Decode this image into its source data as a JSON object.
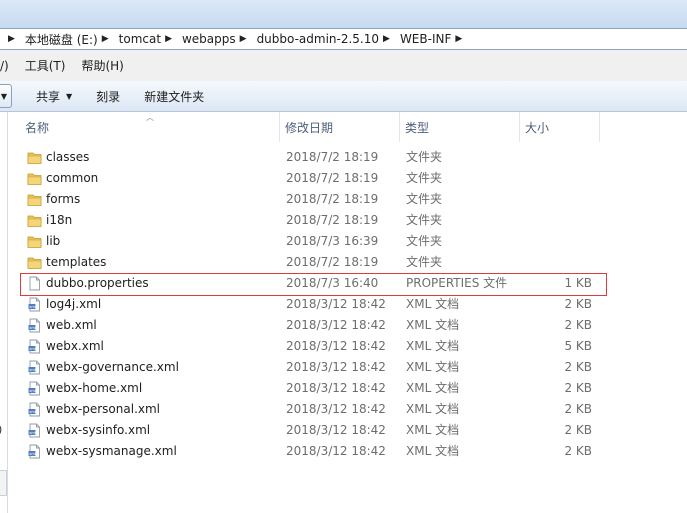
{
  "address": {
    "crumbs": [
      "本地磁盘 (E:)",
      "tomcat",
      "webapps",
      "dubbo-admin-2.5.10",
      "WEB-INF"
    ]
  },
  "menu": {
    "items": [
      "/)",
      "工具(T)",
      "帮助(H)"
    ]
  },
  "toolbar": {
    "share_label": "共享",
    "burn_label": "刻录",
    "new_folder_label": "新建文件夹"
  },
  "columns": {
    "name": "名称",
    "date": "修改日期",
    "type": "类型",
    "size": "大小"
  },
  "files": [
    {
      "name": "classes",
      "date": "2018/7/2 18:19",
      "type": "文件夹",
      "size": "",
      "icon": "folder-icon"
    },
    {
      "name": "common",
      "date": "2018/7/2 18:19",
      "type": "文件夹",
      "size": "",
      "icon": "folder-icon"
    },
    {
      "name": "forms",
      "date": "2018/7/2 18:19",
      "type": "文件夹",
      "size": "",
      "icon": "folder-icon"
    },
    {
      "name": "i18n",
      "date": "2018/7/2 18:19",
      "type": "文件夹",
      "size": "",
      "icon": "folder-icon"
    },
    {
      "name": "lib",
      "date": "2018/7/3 16:39",
      "type": "文件夹",
      "size": "",
      "icon": "folder-icon"
    },
    {
      "name": "templates",
      "date": "2018/7/2 18:19",
      "type": "文件夹",
      "size": "",
      "icon": "folder-icon"
    },
    {
      "name": "dubbo.properties",
      "date": "2018/7/3 16:40",
      "type": "PROPERTIES 文件",
      "size": "1 KB",
      "icon": "file-icon"
    },
    {
      "name": "log4j.xml",
      "date": "2018/3/12 18:42",
      "type": "XML 文档",
      "size": "2 KB",
      "icon": "xml-file-icon"
    },
    {
      "name": "web.xml",
      "date": "2018/3/12 18:42",
      "type": "XML 文档",
      "size": "2 KB",
      "icon": "xml-file-icon"
    },
    {
      "name": "webx.xml",
      "date": "2018/3/12 18:42",
      "type": "XML 文档",
      "size": "5 KB",
      "icon": "xml-file-icon"
    },
    {
      "name": "webx-governance.xml",
      "date": "2018/3/12 18:42",
      "type": "XML 文档",
      "size": "2 KB",
      "icon": "xml-file-icon"
    },
    {
      "name": "webx-home.xml",
      "date": "2018/3/12 18:42",
      "type": "XML 文档",
      "size": "2 KB",
      "icon": "xml-file-icon"
    },
    {
      "name": "webx-personal.xml",
      "date": "2018/3/12 18:42",
      "type": "XML 文档",
      "size": "2 KB",
      "icon": "xml-file-icon"
    },
    {
      "name": "webx-sysinfo.xml",
      "date": "2018/3/12 18:42",
      "type": "XML 文档",
      "size": "2 KB",
      "icon": "xml-file-icon"
    },
    {
      "name": "webx-sysmanage.xml",
      "date": "2018/3/12 18:42",
      "type": "XML 文档",
      "size": "2 KB",
      "icon": "xml-file-icon"
    }
  ],
  "highlighted_row": "dubbo.properties",
  "colors": {
    "highlight_border": "#e03a3a",
    "folder": "#e8c25a",
    "header_text": "#4c607a"
  }
}
